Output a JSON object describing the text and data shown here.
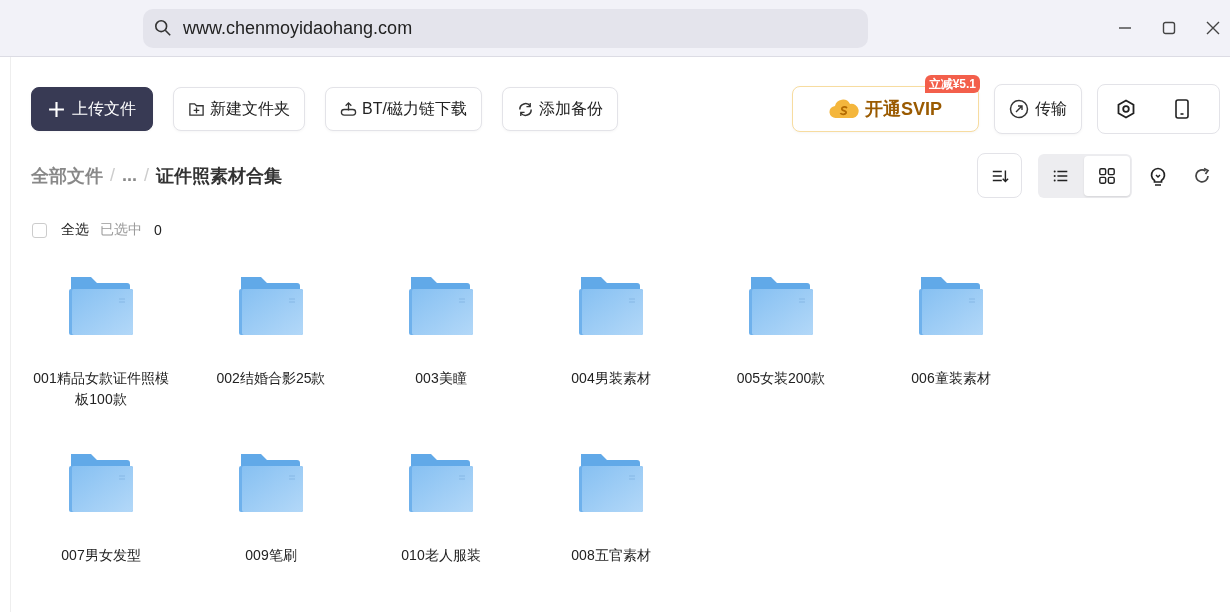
{
  "address_bar": {
    "url": "www.chenmoyidaohang.com"
  },
  "toolbar": {
    "upload": "上传文件",
    "buttons": [
      {
        "kind": "new-folder",
        "label": "新建文件夹"
      },
      {
        "kind": "bt",
        "label": "BT/磁力链下载"
      },
      {
        "kind": "backup",
        "label": "添加备份"
      }
    ],
    "svip": {
      "label": "开通SVIP",
      "badge": "立减¥5.1"
    },
    "transfer": "传输"
  },
  "breadcrumb": [
    {
      "kind": "link",
      "text": "全部文件"
    },
    {
      "kind": "separator",
      "text": "/"
    },
    {
      "kind": "link",
      "text": "..."
    },
    {
      "kind": "separator",
      "text": "/"
    },
    {
      "kind": "current",
      "text": "证件照素材合集"
    }
  ],
  "view_modes": [
    {
      "kind": "list",
      "selected": false
    },
    {
      "kind": "grid",
      "selected": true
    }
  ],
  "selection": {
    "checked": false,
    "label": "全选",
    "selected_label": "已选中",
    "count": "0"
  },
  "folders": [
    {
      "name": "001精品女款证件照模板100款"
    },
    {
      "name": "002结婚合影25款"
    },
    {
      "name": "003美瞳"
    },
    {
      "name": "004男装素材"
    },
    {
      "name": "005女装200款"
    },
    {
      "name": "006童装素材"
    },
    {
      "name": "007男女发型"
    },
    {
      "name": "009笔刷"
    },
    {
      "name": "010老人服装"
    },
    {
      "name": "008五官素材"
    }
  ]
}
